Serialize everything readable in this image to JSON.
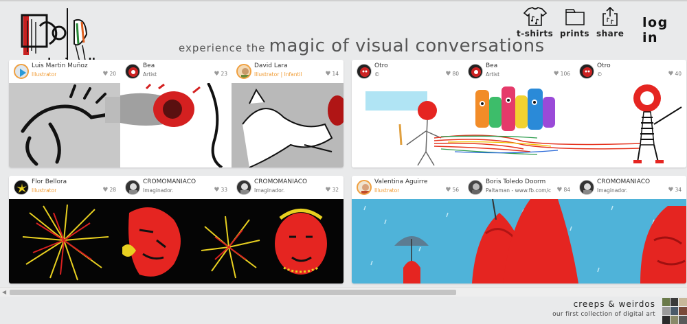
{
  "header": {
    "logo_text": "speak visually",
    "tagline_small": "experience the",
    "tagline_big": "magic of visual conversations",
    "nav": [
      {
        "label": "t-shirts",
        "icon": "tshirt-icon"
      },
      {
        "label": "prints",
        "icon": "prints-icon"
      },
      {
        "label": "share",
        "icon": "share-icon"
      }
    ],
    "login_label": "log in"
  },
  "cards": [
    {
      "artists": [
        {
          "name": "Luis Martin Muñoz",
          "role": "Illustrator",
          "likes": "20"
        },
        {
          "name": "Bea",
          "role": "Artist",
          "likes": "23"
        },
        {
          "name": "David Lara",
          "role": "Illustrator | Infantil",
          "likes": "14"
        }
      ]
    },
    {
      "artists": [
        {
          "name": "Otro",
          "role": "©",
          "likes": "80"
        },
        {
          "name": "Bea",
          "role": "Artist",
          "likes": "106"
        },
        {
          "name": "Otro",
          "role": "©",
          "likes": "40"
        }
      ]
    },
    {
      "artists": [
        {
          "name": "Flor Bellora",
          "role": "Illustrator",
          "likes": "28"
        },
        {
          "name": "CROMOMANIACO",
          "role": "Imaginador.",
          "likes": "33"
        },
        {
          "name": "CROMOMANIACO",
          "role": "Imaginador.",
          "likes": "32"
        }
      ]
    },
    {
      "artists": [
        {
          "name": "Valentina Aguirre",
          "role": "Illustrator",
          "likes": "56"
        },
        {
          "name": "Boris Toledo Doorm",
          "role": "Paltaman - www.fb.com/cr...",
          "likes": "84"
        },
        {
          "name": "CROMOMANIACO",
          "role": "Imaginador.",
          "likes": "34"
        }
      ]
    }
  ],
  "footer": {
    "title": "creeps & weirdos",
    "subtitle": "our first collection of digital art"
  },
  "colors": {
    "accent_orange": "#f09a30",
    "sky_blue": "#4fb3d9",
    "art_red": "#e52521"
  }
}
